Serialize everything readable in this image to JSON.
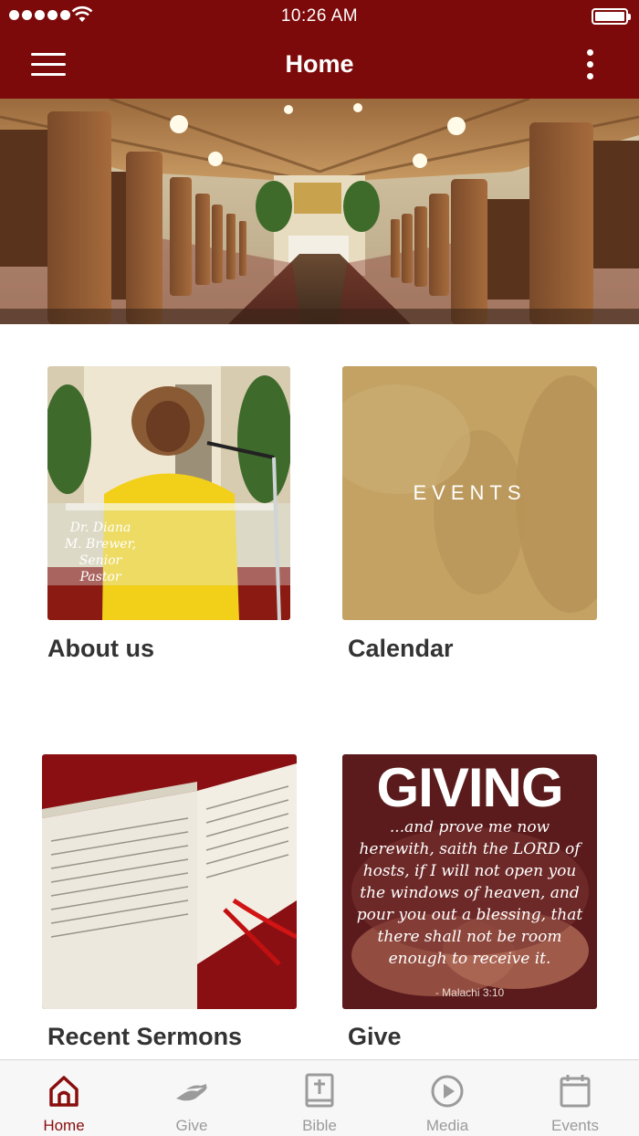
{
  "status_bar": {
    "time": "10:26 AM"
  },
  "header": {
    "title": "Home"
  },
  "tiles": [
    {
      "label": "About us",
      "caption": "Dr. Diana M. Brewer, Senior Pastor"
    },
    {
      "label": "Calendar",
      "overlay_text": "EVENTS"
    },
    {
      "label": "Recent Sermons"
    },
    {
      "label": "Give",
      "overlay_title": "GIVING",
      "verse": "...and prove me now herewith, saith the LORD of hosts, if I will not open you the windows of heaven, and pour you out a blessing, that there shall not be room enough to receive it.",
      "verse_ref": "- Malachi 3:10"
    }
  ],
  "tabs": [
    {
      "label": "Home",
      "icon": "home-icon",
      "active": true
    },
    {
      "label": "Give",
      "icon": "give-hand-icon",
      "active": false
    },
    {
      "label": "Bible",
      "icon": "bible-icon",
      "active": false
    },
    {
      "label": "Media",
      "icon": "play-icon",
      "active": false
    },
    {
      "label": "Events",
      "icon": "calendar-icon",
      "active": false
    }
  ],
  "colors": {
    "brand": "#7d0a0a",
    "tab_active": "#8a0d0d",
    "tab_inactive": "#9b9b9b"
  }
}
